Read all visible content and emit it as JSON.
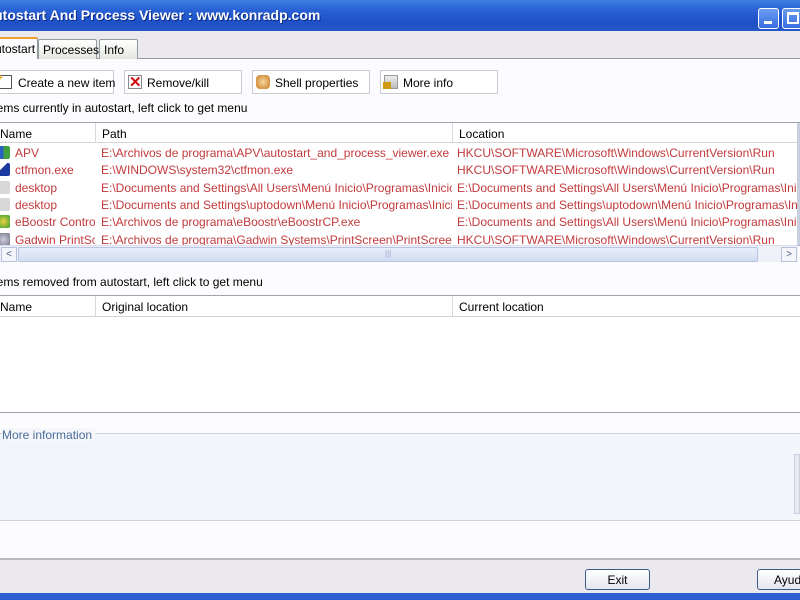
{
  "window": {
    "title": "Autostart And Process Viewer : www.konradp.com"
  },
  "tabs": [
    {
      "label": "Autostart",
      "selected": true
    },
    {
      "label": "Processes"
    },
    {
      "label": "Info"
    }
  ],
  "toolbar": {
    "create": "Create a new item",
    "remove": "Remove/kill",
    "shell": "Shell properties",
    "more": "More info"
  },
  "autostart": {
    "label": "Items currently in autostart, left click to get menu",
    "columns": [
      "Name",
      "Path",
      "Location"
    ],
    "rows": [
      {
        "name": "APV",
        "path": "E:\\Archivos de programa\\APV\\autostart_and_process_viewer.exe",
        "location": "HKCU\\SOFTWARE\\Microsoft\\Windows\\CurrentVersion\\Run",
        "icon": "apv-icon"
      },
      {
        "name": "ctfmon.exe",
        "path": "E:\\WINDOWS\\system32\\ctfmon.exe",
        "location": "HKCU\\SOFTWARE\\Microsoft\\Windows\\CurrentVersion\\Run",
        "icon": "ctfmon-icon"
      },
      {
        "name": "desktop",
        "path": "E:\\Documents and Settings\\All Users\\Menú Inicio\\Programas\\Inicio\\desktop.ini",
        "location": "E:\\Documents and Settings\\All Users\\Menú Inicio\\Programas\\Inicio\\desktop.ini",
        "icon": "ini-file-icon"
      },
      {
        "name": "desktop",
        "path": "E:\\Documents and Settings\\uptodown\\Menú Inicio\\Programas\\Inicio\\desktop.ini",
        "location": "E:\\Documents and Settings\\uptodown\\Menú Inicio\\Programas\\Inicio\\desktop.ini",
        "icon": "ini-file-icon"
      },
      {
        "name": "eBoostr Control Panel",
        "path": "E:\\Archivos de programa\\eBoostr\\eBoostrCP.exe",
        "location": "E:\\Documents and Settings\\All Users\\Menú Inicio\\Programas\\Inicio\\eBoostr",
        "icon": "eboostr-icon"
      },
      {
        "name": "Gadwin PrintScreen",
        "path": "E:\\Archivos de programa\\Gadwin Systems\\PrintScreen\\PrintScreen.exe /nosplash",
        "location": "HKCU\\SOFTWARE\\Microsoft\\Windows\\CurrentVersion\\Run",
        "icon": "printscreen-icon"
      }
    ]
  },
  "removed": {
    "label": "Items removed from autostart, left click to get menu",
    "columns": [
      "Name",
      "Original location",
      "Current location"
    ],
    "rows": []
  },
  "more_information": {
    "label": "More information"
  },
  "buttons": {
    "exit": "Exit",
    "help": "Ayuda"
  },
  "colors": {
    "item_text": "#c23a3c",
    "titlebar": "#2a63d6"
  }
}
